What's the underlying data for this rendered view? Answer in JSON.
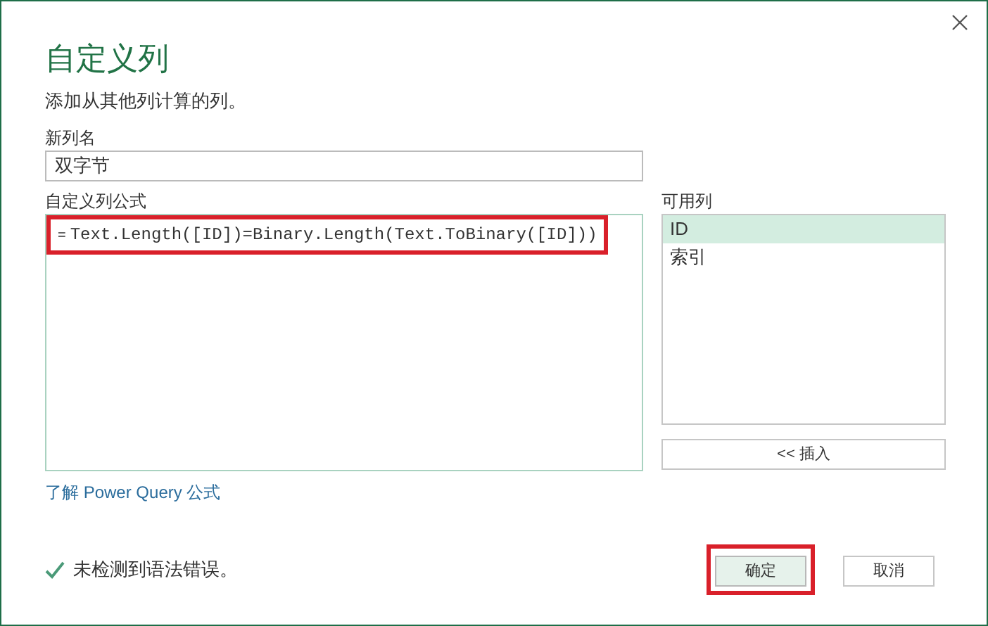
{
  "dialog": {
    "title": "自定义列",
    "subtitle": "添加从其他列计算的列。"
  },
  "new_column_name": {
    "label": "新列名",
    "value": "双字节"
  },
  "formula": {
    "label": "自定义列公式",
    "prefix": "=",
    "value": "Text.Length([ID])=Binary.Length(Text.ToBinary([ID]))",
    "highlighted": true
  },
  "available_columns": {
    "label": "可用列",
    "items": [
      {
        "label": "ID",
        "selected": true
      },
      {
        "label": "索引",
        "selected": false
      }
    ],
    "insert_button": "<< 插入"
  },
  "learn_link": "了解 Power Query 公式",
  "status": {
    "text": "未检测到语法错误。",
    "valid": true
  },
  "buttons": [
    {
      "label": "确定",
      "primary": true,
      "highlighted": true
    },
    {
      "label": "取消",
      "primary": false,
      "highlighted": false
    }
  ]
}
